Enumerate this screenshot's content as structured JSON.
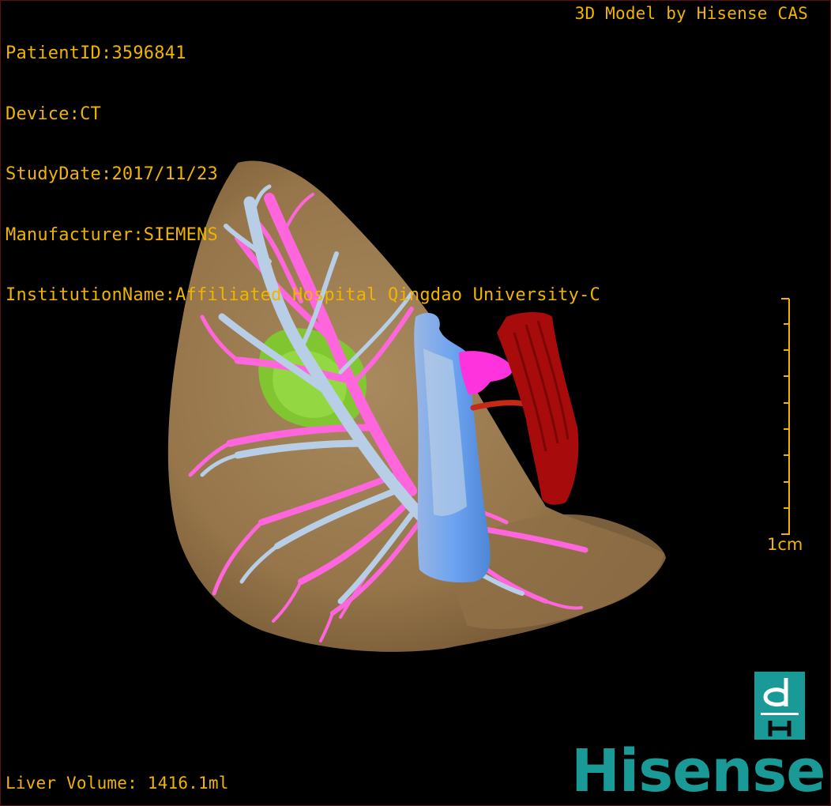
{
  "study_info": {
    "patient_id": "PatientID:3596841",
    "device": "Device:CT",
    "study_date": "StudyDate:2017/11/23",
    "manufacturer": "Manufacturer:SIEMENS",
    "institution": "InstitutionName:Affiliated Hospital Qingdao University-C"
  },
  "model_credit": "3D Model by Hisense CAS",
  "measurement": {
    "liver_volume": "Liver Volume: 1416.1ml"
  },
  "scale": {
    "label": "1cm"
  },
  "logo": {
    "brand": "Hisense",
    "mark_icon": "dh-mark-icon"
  },
  "colors": {
    "overlay_text": "#f0b400",
    "liver": "#9c7c52",
    "portal_vein": "#ff66dd",
    "hepatic_vein": "#b8cde6",
    "vena_cava": "#6aa2f0",
    "tumor": "#7bd22c",
    "aorta": "#a80b0b",
    "brand": "#1a9a97"
  }
}
